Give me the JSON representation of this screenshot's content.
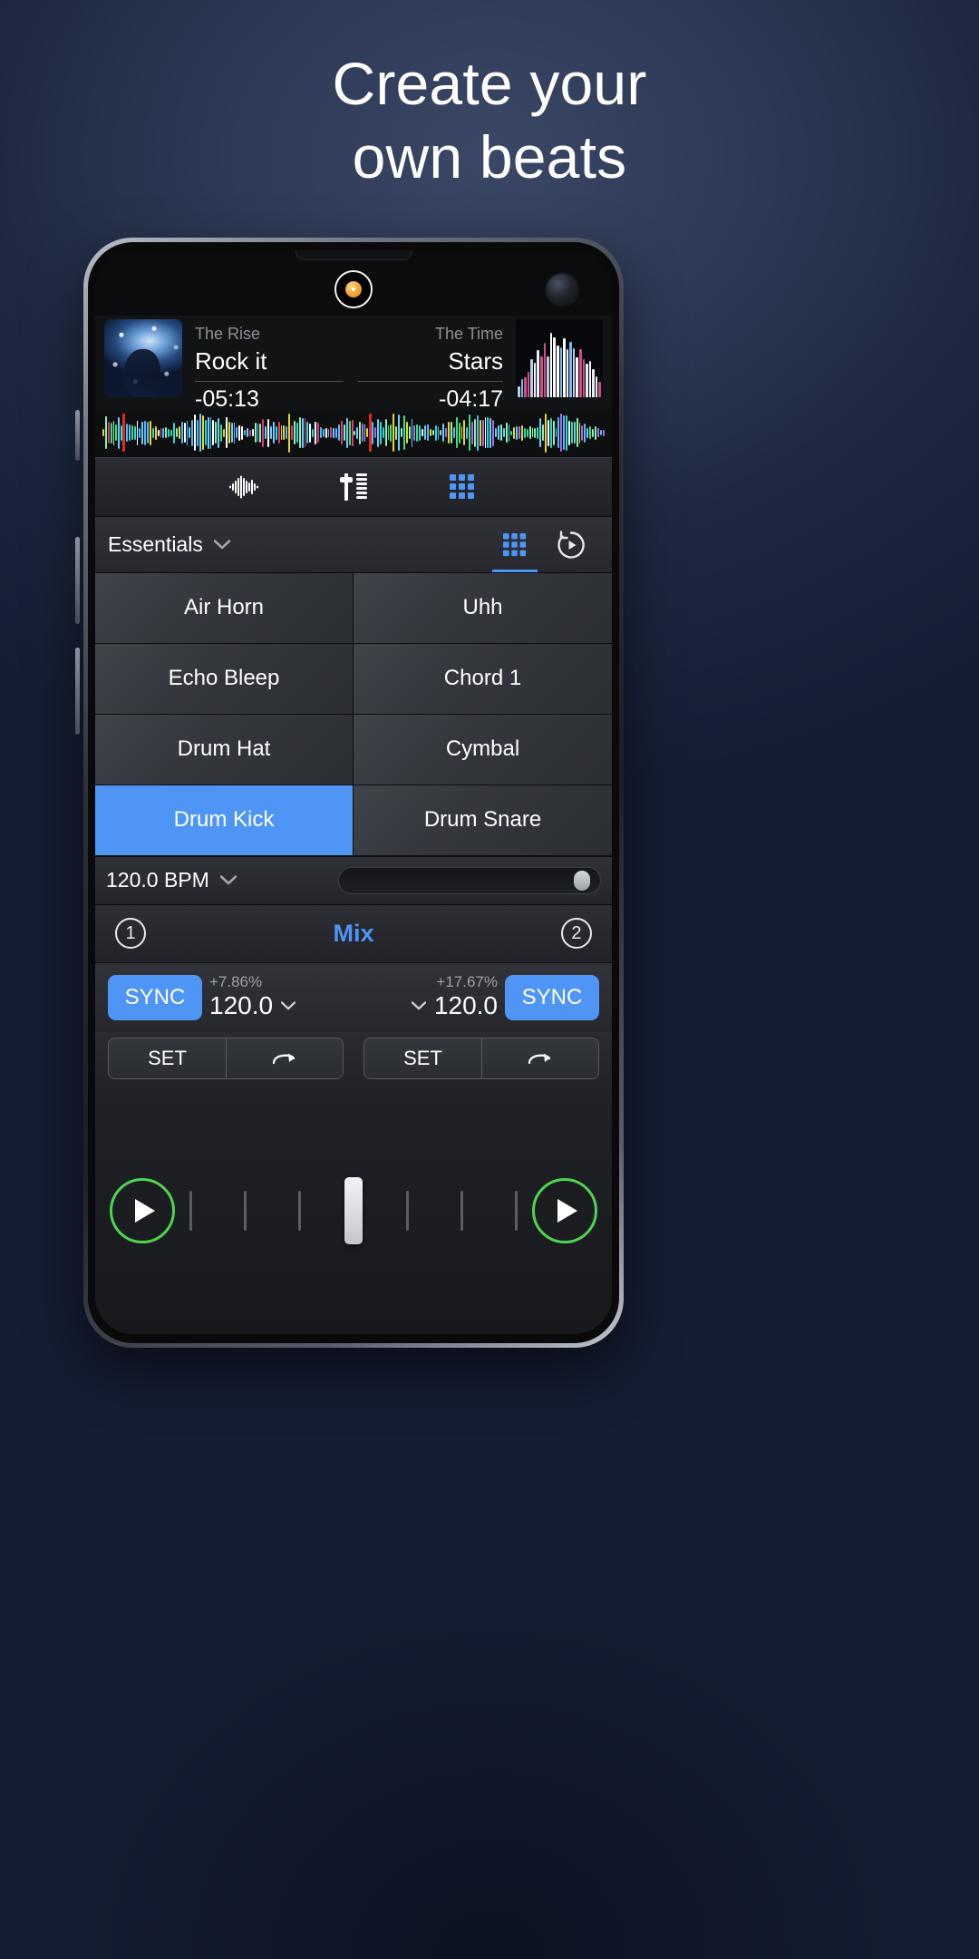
{
  "promo": {
    "headline_line1": "Create your",
    "headline_line2": "own beats"
  },
  "decks": {
    "left": {
      "artist": "The Rise",
      "title": "Rock it",
      "time_remaining": "-05:13"
    },
    "right": {
      "artist": "The Time",
      "title": "Stars",
      "time_remaining": "-04:17"
    }
  },
  "toolbar": {
    "items": [
      {
        "icon": "waveform-icon",
        "label": "Waveform"
      },
      {
        "icon": "mixer-fader-icon",
        "label": "Mixer"
      },
      {
        "icon": "pad-grid-icon",
        "label": "Pads"
      }
    ]
  },
  "pad_panel": {
    "category": "Essentials",
    "chevron": "⌄",
    "tabs": [
      {
        "name": "grid-tab",
        "active": true
      },
      {
        "name": "loop-tab",
        "active": false
      }
    ],
    "pads": [
      {
        "label": "Air Horn",
        "active": false
      },
      {
        "label": "Uhh",
        "active": false
      },
      {
        "label": "Echo Bleep",
        "active": false
      },
      {
        "label": "Chord 1",
        "active": false
      },
      {
        "label": "Drum Hat",
        "active": false
      },
      {
        "label": "Cymbal",
        "active": false
      },
      {
        "label": "Drum Kick",
        "active": true
      },
      {
        "label": "Drum Snare",
        "active": false
      }
    ]
  },
  "bpm_bar": {
    "value": "120.0 BPM",
    "slider_position_pct": 94
  },
  "mix_row": {
    "left_deck_number": "1",
    "right_deck_number": "2",
    "label": "Mix"
  },
  "sync_left": {
    "sync_label": "SYNC",
    "pitch_percent": "+7.86%",
    "bpm": "120.0"
  },
  "sync_right": {
    "sync_label": "SYNC",
    "pitch_percent": "+17.67%",
    "bpm": "120.0"
  },
  "set_row": {
    "left_set_label": "SET",
    "left_loop_icon": "loop-arrow-icon",
    "right_set_label": "SET",
    "right_loop_icon": "loop-arrow-icon"
  },
  "transport": {
    "left_play_icon": "play-icon",
    "right_play_icon": "play-icon",
    "crossfader_position_pct": 50
  },
  "colors": {
    "accent_blue": "#4e95f5",
    "play_green": "#4fd44f",
    "cue_red": "#e02a1c",
    "camera_orange": "#f4ab3c"
  }
}
